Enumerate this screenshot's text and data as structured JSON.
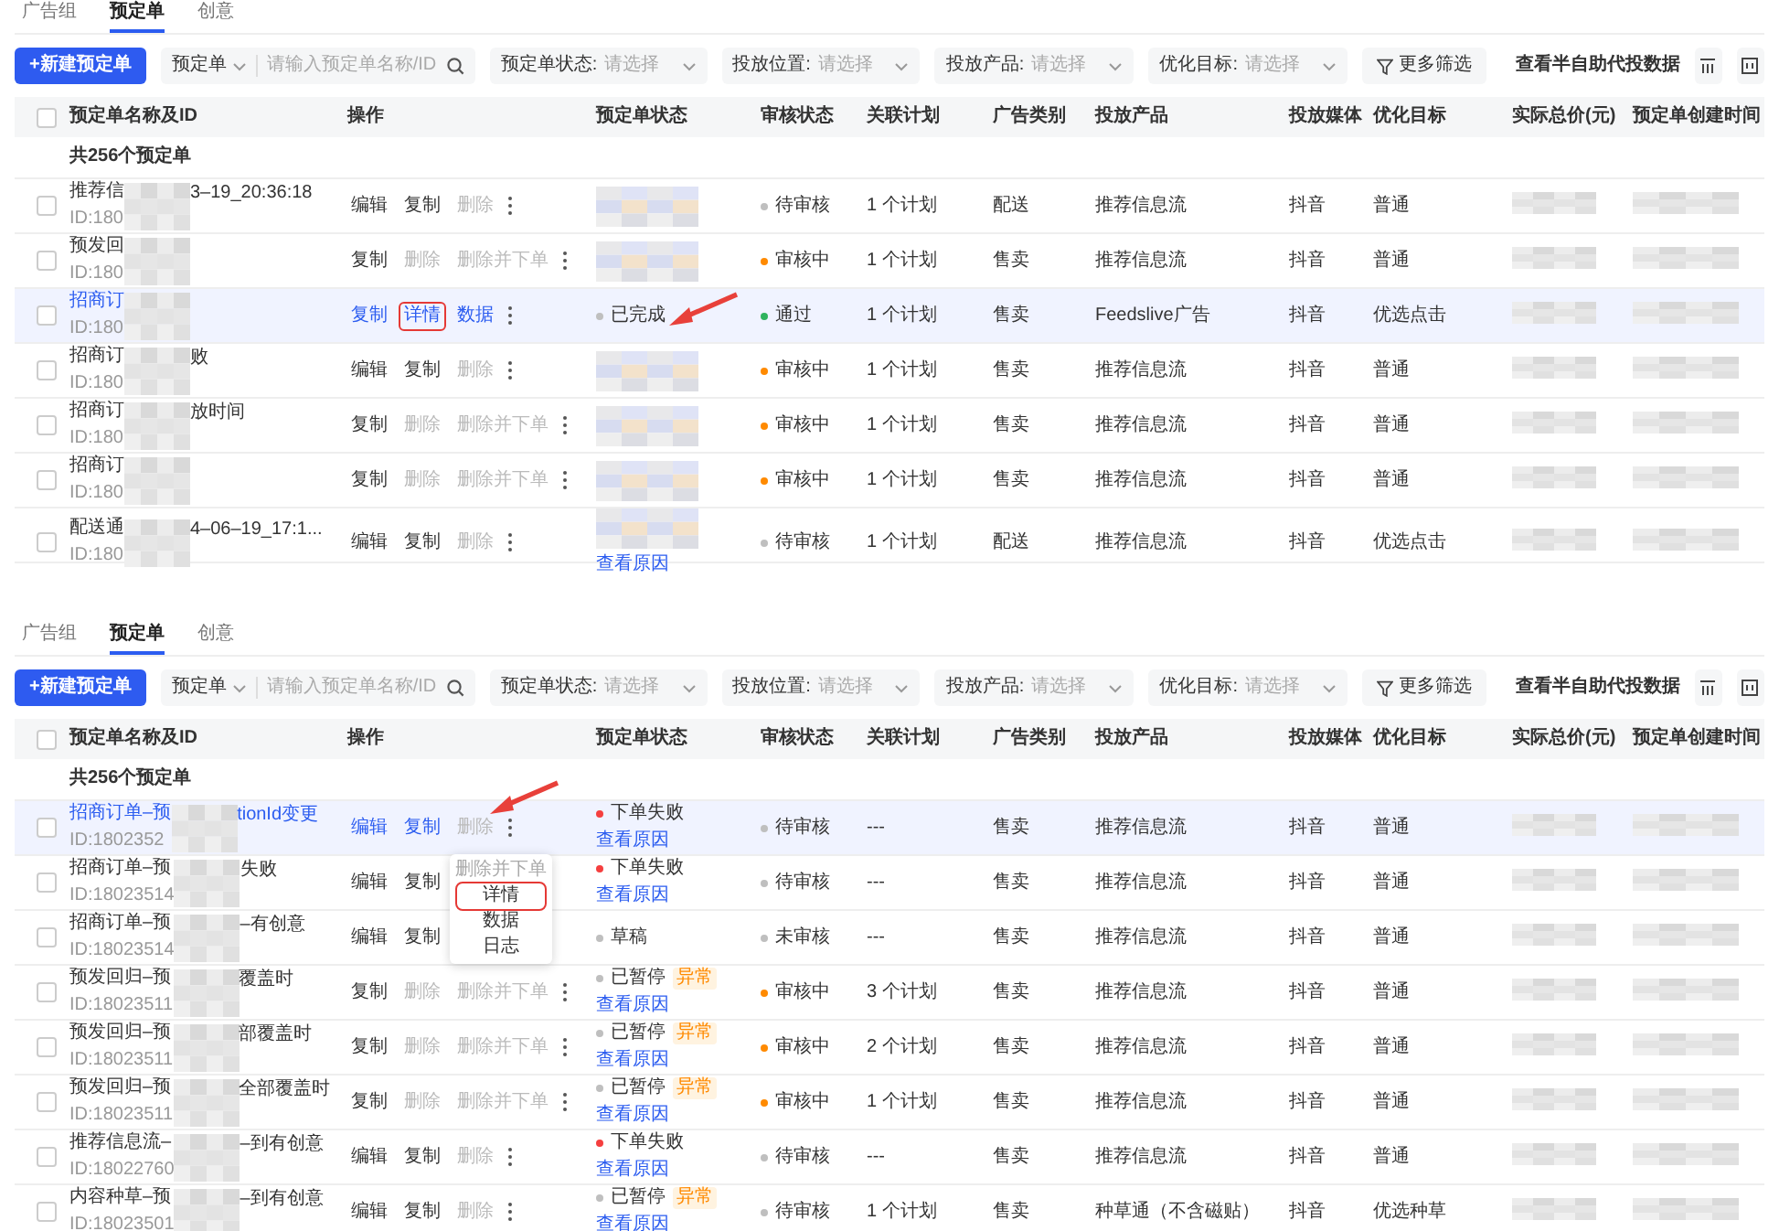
{
  "panels": [
    {
      "tabs": [
        {
          "label": "广告组",
          "selected": false
        },
        {
          "label": "预定单",
          "selected": true
        },
        {
          "label": "创意",
          "selected": false
        }
      ],
      "toolbar": {
        "create_button": "+新建预定单",
        "search": {
          "scope": "预定单",
          "placeholder": "请输入预定单名称/ID"
        },
        "filters": [
          {
            "label": "预定单状态:",
            "placeholder": "请选择"
          },
          {
            "label": "投放位置:",
            "placeholder": "请选择"
          },
          {
            "label": "投放产品:",
            "placeholder": "请选择"
          },
          {
            "label": "优化目标:",
            "placeholder": "请选择"
          }
        ],
        "more_filters": "更多筛选",
        "link": "查看半自助代投数据"
      },
      "header_checked": false,
      "columns": [
        "预定单名称及ID",
        "操作",
        "预定单状态",
        "审核状态",
        "关联计划",
        "广告类别",
        "投放产品",
        "投放媒体",
        "优化目标",
        "实际总价(元)",
        "预定单创建时间"
      ],
      "count": "共256个预定单",
      "rows": [
        {
          "checked": false,
          "highlighted": false,
          "name_start": "推荐信",
          "name_end": "3–19_20:36:18",
          "id": "ID:180",
          "actions": [
            {
              "label": "编辑",
              "disabled": false
            },
            {
              "label": "复制",
              "disabled": false
            },
            {
              "label": "删除",
              "disabled": true
            }
          ],
          "status": {
            "kind": "blurred"
          },
          "audit": {
            "label": "待审核",
            "color": "#bfbfbf"
          },
          "plans": "1 个计划",
          "category": "配送",
          "product": "推荐信息流",
          "media": "抖音",
          "goal": "普通"
        },
        {
          "checked": false,
          "highlighted": false,
          "name_start": "预发回",
          "id": "ID:180",
          "actions": [
            {
              "label": "复制",
              "disabled": false
            },
            {
              "label": "删除",
              "disabled": true
            },
            {
              "label": "删除并下单",
              "disabled": true
            }
          ],
          "status": {
            "kind": "blurred"
          },
          "audit": {
            "label": "审核中",
            "color": "#ff8a00"
          },
          "plans": "1 个计划",
          "category": "售卖",
          "product": "推荐信息流",
          "media": "抖音",
          "goal": "普通"
        },
        {
          "checked": false,
          "highlighted": true,
          "status_arrow": true,
          "name_start": "招商订",
          "id": "ID:180",
          "actions": [
            {
              "label": "复制",
              "disabled": false
            },
            {
              "label": "详情",
              "disabled": false,
              "boxed": true
            },
            {
              "label": "数据",
              "disabled": false
            }
          ],
          "status": {
            "kind": "text",
            "label": "已完成",
            "color": "#bfbfbf"
          },
          "audit": {
            "label": "通过",
            "color": "#2fb35e"
          },
          "plans": "1 个计划",
          "category": "售卖",
          "product": "Feedslive广告",
          "media": "抖音",
          "goal": "优选点击"
        },
        {
          "checked": false,
          "highlighted": false,
          "name_start": "招商订",
          "name_end": "败",
          "id": "ID:180",
          "actions": [
            {
              "label": "编辑",
              "disabled": false
            },
            {
              "label": "复制",
              "disabled": false
            },
            {
              "label": "删除",
              "disabled": true
            }
          ],
          "status": {
            "kind": "blurred"
          },
          "audit": {
            "label": "审核中",
            "color": "#ff8a00"
          },
          "plans": "1 个计划",
          "category": "售卖",
          "product": "推荐信息流",
          "media": "抖音",
          "goal": "普通"
        },
        {
          "checked": false,
          "highlighted": false,
          "name_start": "招商订",
          "name_end": "放时间",
          "id": "ID:180",
          "actions": [
            {
              "label": "复制",
              "disabled": false
            },
            {
              "label": "删除",
              "disabled": true
            },
            {
              "label": "删除并下单",
              "disabled": true
            }
          ],
          "status": {
            "kind": "blurred"
          },
          "audit": {
            "label": "审核中",
            "color": "#ff8a00"
          },
          "plans": "1 个计划",
          "category": "售卖",
          "product": "推荐信息流",
          "media": "抖音",
          "goal": "普通"
        },
        {
          "checked": false,
          "highlighted": false,
          "name_start": "招商订",
          "id": "ID:180",
          "actions": [
            {
              "label": "复制",
              "disabled": false
            },
            {
              "label": "删除",
              "disabled": true
            },
            {
              "label": "删除并下单",
              "disabled": true
            }
          ],
          "status": {
            "kind": "blurred"
          },
          "audit": {
            "label": "审核中",
            "color": "#ff8a00"
          },
          "plans": "1 个计划",
          "category": "售卖",
          "product": "推荐信息流",
          "media": "抖音",
          "goal": "普通"
        },
        {
          "checked": false,
          "highlighted": false,
          "name_start": "配送通",
          "name_end": "4–06–19_17:1...",
          "id": "ID:180",
          "actions": [
            {
              "label": "编辑",
              "disabled": false
            },
            {
              "label": "复制",
              "disabled": false
            },
            {
              "label": "删除",
              "disabled": true
            }
          ],
          "status": {
            "kind": "blurred",
            "link": "查看原因"
          },
          "audit": {
            "label": "待审核",
            "color": "#bfbfbf"
          },
          "plans": "1 个计划",
          "category": "配送",
          "product": "推荐信息流",
          "media": "抖音",
          "goal": "优选点击"
        }
      ]
    },
    {
      "tabs": [
        {
          "label": "广告组",
          "selected": false
        },
        {
          "label": "预定单",
          "selected": true
        },
        {
          "label": "创意",
          "selected": false
        }
      ],
      "toolbar": {
        "create_button": "+新建预定单",
        "search": {
          "scope": "预定单",
          "placeholder": "请输入预定单名称/ID"
        },
        "filters": [
          {
            "label": "预定单状态:",
            "placeholder": "请选择"
          },
          {
            "label": "投放位置:",
            "placeholder": "请选择"
          },
          {
            "label": "投放产品:",
            "placeholder": "请选择"
          },
          {
            "label": "优化目标:",
            "placeholder": "请选择"
          }
        ],
        "more_filters": "更多筛选",
        "link": "查看半自助代投数据"
      },
      "header_checked": false,
      "columns": [
        "预定单名称及ID",
        "操作",
        "预定单状态",
        "审核状态",
        "关联计划",
        "广告类别",
        "投放产品",
        "投放媒体",
        "优化目标",
        "实际总价(元)",
        "预定单创建时间"
      ],
      "count": "共256个预定单",
      "rows": [
        {
          "checked": false,
          "highlighted": true,
          "more_arrow": true,
          "name_start": "招商订单–预",
          "name_end": "tionId变更",
          "id": "ID:1802352",
          "actions": [
            {
              "label": "编辑",
              "disabled": false
            },
            {
              "label": "复制",
              "disabled": false
            },
            {
              "label": "删除",
              "disabled": true
            }
          ],
          "menu": [
            {
              "label": "删除并下单",
              "disabled": true
            },
            {
              "label": "详情",
              "disabled": false,
              "boxed": true
            },
            {
              "label": "数据",
              "disabled": false
            },
            {
              "label": "日志",
              "disabled": false
            }
          ],
          "status": {
            "kind": "text",
            "label": "下单失败",
            "color": "#f53f3f",
            "link": "查看原因"
          },
          "audit": {
            "label": "待审核",
            "color": "#bfbfbf"
          },
          "plans": "---",
          "category": "售卖",
          "product": "推荐信息流",
          "media": "抖音",
          "goal": "普通"
        },
        {
          "checked": false,
          "highlighted": false,
          "name_start": "招商订单–预",
          "name_end": "失败",
          "id": "ID:18023514",
          "actions": [
            {
              "label": "编辑",
              "disabled": false
            },
            {
              "label": "复制",
              "disabled": false
            }
          ],
          "status": {
            "kind": "text",
            "label": "下单失败",
            "color": "#f53f3f",
            "link": "查看原因"
          },
          "audit": {
            "label": "待审核",
            "color": "#bfbfbf"
          },
          "plans": "---",
          "category": "售卖",
          "product": "推荐信息流",
          "media": "抖音",
          "goal": "普通"
        },
        {
          "checked": false,
          "highlighted": false,
          "name_start": "招商订单–预",
          "name_end": "–有创意",
          "id": "ID:18023514",
          "actions": [
            {
              "label": "编辑",
              "disabled": false
            },
            {
              "label": "复制",
              "disabled": false
            }
          ],
          "status": {
            "kind": "text",
            "label": "草稿",
            "color": "#bfbfbf"
          },
          "audit": {
            "label": "未审核",
            "color": "#bfbfbf"
          },
          "plans": "---",
          "category": "售卖",
          "product": "推荐信息流",
          "media": "抖音",
          "goal": "普通"
        },
        {
          "checked": false,
          "highlighted": false,
          "name_start": "预发回归–预",
          "name_end": "覆盖时",
          "id": "ID:18023511",
          "actions": [
            {
              "label": "复制",
              "disabled": false
            },
            {
              "label": "删除",
              "disabled": true
            },
            {
              "label": "删除并下单",
              "disabled": true
            }
          ],
          "status": {
            "kind": "text",
            "label": "已暂停",
            "color": "#bfbfbf",
            "tag": "异常",
            "link": "查看原因"
          },
          "audit": {
            "label": "审核中",
            "color": "#ff8a00"
          },
          "plans": "3 个计划",
          "category": "售卖",
          "product": "推荐信息流",
          "media": "抖音",
          "goal": "普通"
        },
        {
          "checked": false,
          "highlighted": false,
          "name_start": "预发回归–预",
          "name_end": "部覆盖时",
          "id": "ID:18023511",
          "actions": [
            {
              "label": "复制",
              "disabled": false
            },
            {
              "label": "删除",
              "disabled": true
            },
            {
              "label": "删除并下单",
              "disabled": true
            }
          ],
          "status": {
            "kind": "text",
            "label": "已暂停",
            "color": "#bfbfbf",
            "tag": "异常",
            "link": "查看原因"
          },
          "audit": {
            "label": "审核中",
            "color": "#ff8a00"
          },
          "plans": "2 个计划",
          "category": "售卖",
          "product": "推荐信息流",
          "media": "抖音",
          "goal": "普通"
        },
        {
          "checked": false,
          "highlighted": false,
          "name_start": "预发回归–预",
          "name_end": "全部覆盖时",
          "id": "ID:18023511",
          "actions": [
            {
              "label": "复制",
              "disabled": false
            },
            {
              "label": "删除",
              "disabled": true
            },
            {
              "label": "删除并下单",
              "disabled": true
            }
          ],
          "status": {
            "kind": "text",
            "label": "已暂停",
            "color": "#bfbfbf",
            "tag": "异常",
            "link": "查看原因"
          },
          "audit": {
            "label": "审核中",
            "color": "#ff8a00"
          },
          "plans": "1 个计划",
          "category": "售卖",
          "product": "推荐信息流",
          "media": "抖音",
          "goal": "普通"
        },
        {
          "checked": false,
          "highlighted": false,
          "name_start": "推荐信息流–",
          "name_end": "–到有创意",
          "id": "ID:18022760",
          "actions": [
            {
              "label": "编辑",
              "disabled": false
            },
            {
              "label": "复制",
              "disabled": false
            },
            {
              "label": "删除",
              "disabled": true
            }
          ],
          "status": {
            "kind": "text",
            "label": "下单失败",
            "color": "#f53f3f",
            "link": "查看原因"
          },
          "audit": {
            "label": "待审核",
            "color": "#bfbfbf"
          },
          "plans": "---",
          "category": "售卖",
          "product": "推荐信息流",
          "media": "抖音",
          "goal": "普通"
        },
        {
          "checked": false,
          "highlighted": false,
          "name_start": "内容种草–预",
          "name_end": "–到有创意",
          "id": "ID:18023501",
          "actions": [
            {
              "label": "编辑",
              "disabled": false
            },
            {
              "label": "复制",
              "disabled": false
            },
            {
              "label": "删除",
              "disabled": true
            }
          ],
          "status": {
            "kind": "text",
            "label": "已暂停",
            "color": "#bfbfbf",
            "tag": "异常",
            "link": "查看原因"
          },
          "audit": {
            "label": "待审核",
            "color": "#bfbfbf"
          },
          "plans": "1 个计划",
          "category": "售卖",
          "product": "种草通（不含磁贴）",
          "media": "抖音",
          "goal": "优选种草"
        }
      ]
    }
  ]
}
